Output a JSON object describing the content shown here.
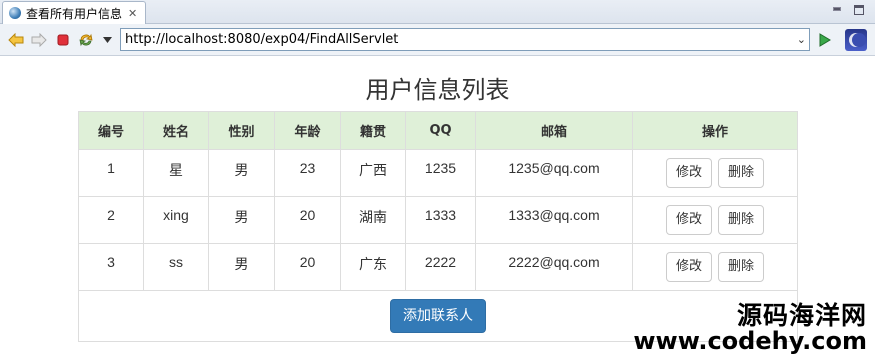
{
  "browser": {
    "tab_title": "查看所有用户信息",
    "tab_close": "✕",
    "url": "http://localhost:8080/exp04/FindAllServlet",
    "dropdown_glyph": "⌄"
  },
  "page": {
    "title": "用户信息列表"
  },
  "table": {
    "headers": [
      "编号",
      "姓名",
      "性别",
      "年龄",
      "籍贯",
      "QQ",
      "邮箱",
      "操作"
    ],
    "rows": [
      {
        "id": "1",
        "name": "星",
        "gender": "男",
        "age": "23",
        "hometown": "广西",
        "qq": "1235",
        "email": "1235@qq.com"
      },
      {
        "id": "2",
        "name": "xing",
        "gender": "男",
        "age": "20",
        "hometown": "湖南",
        "qq": "1333",
        "email": "1333@qq.com"
      },
      {
        "id": "3",
        "name": "ss",
        "gender": "男",
        "age": "20",
        "hometown": "广东",
        "qq": "2222",
        "email": "2222@qq.com"
      }
    ],
    "edit_label": "修改",
    "delete_label": "删除",
    "add_label": "添加联系人"
  },
  "watermark": {
    "line1": "源码海洋网",
    "line2": "www.codehy.com"
  },
  "colors": {
    "header_bg": "#dff0d8",
    "primary": "#337ab7"
  }
}
